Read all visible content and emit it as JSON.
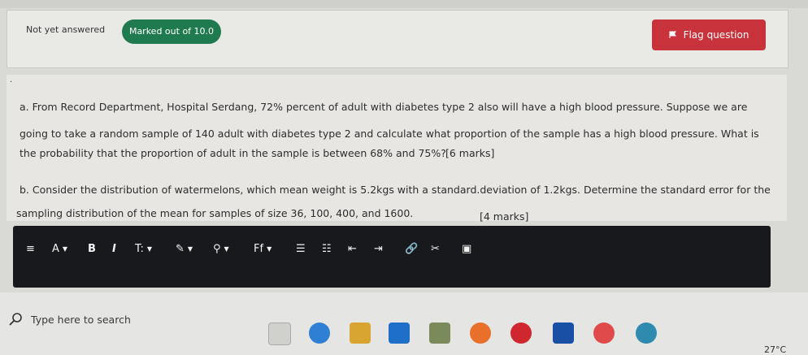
{
  "status": {
    "answered": "Not yet answered",
    "marked": "Marked out of 10.0",
    "flag_label": "Flag question"
  },
  "question": {
    "part_a": {
      "lines": [
        "a. From Record Department, Hospital Serdang, 72% percent of adult with diabetes type 2 also will have a high blood pressure. Suppose we are",
        "going to take a random sample of 140 adult with diabetes type 2 and calculate what proportion of the sample has a high blood pressure. What is",
        "the probability that the proportion of adult in the sample is between 68% and 75%?"
      ],
      "marks": "[6 marks]"
    },
    "part_b": {
      "lines": [
        "b. Consider the distribution of watermelons, which mean weight is 5.2kgs with a standard.deviation of 1.2kgs. Determine the standard error for the",
        "sampling distribution of the mean for samples of size 36, 100, 400, and 1600."
      ],
      "marks": "[4 marks]"
    }
  },
  "editor_toolbar": {
    "items": [
      {
        "name": "paragraph-icon",
        "label": "≡"
      },
      {
        "name": "font-color-icon",
        "label": "A"
      },
      {
        "name": "bold-icon",
        "label": "B"
      },
      {
        "name": "italic-icon",
        "label": "I"
      },
      {
        "name": "font-size-icon",
        "label": "T:"
      },
      {
        "name": "brush-icon",
        "label": "✎"
      },
      {
        "name": "location-icon",
        "label": "⚲"
      },
      {
        "name": "font-family-icon",
        "label": "Ff"
      },
      {
        "name": "bullet-list-icon",
        "label": "☰"
      },
      {
        "name": "numbered-list-icon",
        "label": "☷"
      },
      {
        "name": "outdent-icon",
        "label": "⇤"
      },
      {
        "name": "indent-icon",
        "label": "⇥"
      },
      {
        "name": "link-icon",
        "label": "🔗"
      },
      {
        "name": "unlink-icon",
        "label": "✂"
      },
      {
        "name": "image-icon",
        "label": "▣"
      }
    ]
  },
  "taskbar": {
    "search_placeholder": "Type here to search",
    "temperature": "27°C"
  }
}
